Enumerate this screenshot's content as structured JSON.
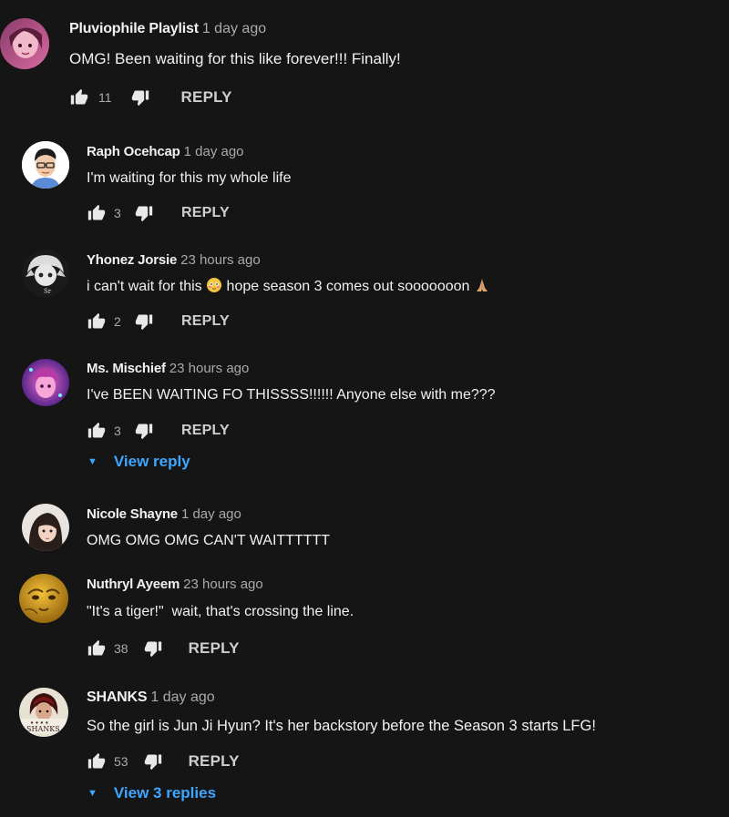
{
  "comments": [
    {
      "author": "Pluviophile Playlist",
      "time": "1 day ago",
      "text": "OMG! Been waiting for this like forever!!! Finally!",
      "likes": "11",
      "reply_label": "REPLY"
    },
    {
      "author": "Raph Ocehcap",
      "time": "1 day ago",
      "text": "I'm waiting for this my whole life",
      "likes": "3",
      "reply_label": "REPLY"
    },
    {
      "author": "Yhonez Jorsie",
      "time": "23 hours ago",
      "text_part1": "i can't wait for this",
      "text_part2": " hope season 3 comes out sooooooon",
      "likes": "2",
      "reply_label": "REPLY"
    },
    {
      "author": "Ms. Mischief",
      "time": "23 hours ago",
      "text": "I've BEEN WAITING FO THISSSS!!!!!! Anyone else with me???",
      "likes": "3",
      "reply_label": "REPLY",
      "view_replies": "View reply"
    },
    {
      "author": "Nicole Shayne",
      "time": "1 day ago",
      "text": "OMG OMG OMG CAN'T WAITTTTTT"
    },
    {
      "author": "Nuthryl Ayeem",
      "time": "23 hours ago",
      "text": "\"It's a tiger!\"  wait, that's crossing the line.",
      "likes": "38",
      "reply_label": "REPLY"
    },
    {
      "author": "SHANKS",
      "time": "1 day ago",
      "text": "So the girl is Jun Ji Hyun? It's her backstory before the Season 3 starts LFG!",
      "likes": "53",
      "reply_label": "REPLY",
      "view_replies": "View 3 replies",
      "avatar_text": "SHANKS"
    }
  ],
  "icons": {
    "like": "thumbs-up-icon",
    "dislike": "thumbs-down-icon",
    "expand": "caret-down-icon",
    "emoji_1": "flushed-face-emoji",
    "emoji_2": "folded-hands-emoji"
  },
  "colors": {
    "background": "#151515",
    "link": "#3ea6ff",
    "secondary_text": "#aaaaaa"
  }
}
